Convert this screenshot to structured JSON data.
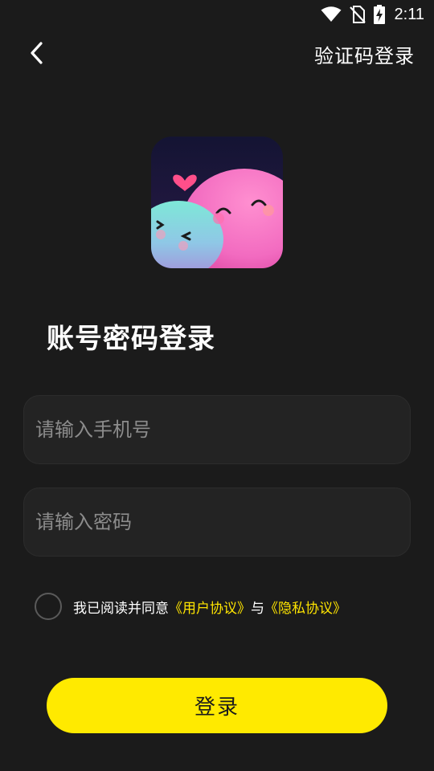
{
  "status_bar": {
    "time": "2:11"
  },
  "nav": {
    "switch_label": "验证码登录"
  },
  "title": "账号密码登录",
  "phone_input": {
    "placeholder": "请输入手机号",
    "value": ""
  },
  "password_input": {
    "placeholder": "请输入密码",
    "value": ""
  },
  "agreement": {
    "prefix": "我已阅读并同意",
    "user_agreement": "《用户协议》",
    "conjunction": "与",
    "privacy_policy": "《隐私协议》",
    "checked": false
  },
  "login_button": {
    "label": "登录"
  },
  "colors": {
    "background": "#1b1b1b",
    "accent": "#ffea00",
    "link": "#ffe500",
    "input_bg": "#232323"
  },
  "icons": [
    "wifi-icon",
    "no-sim-icon",
    "battery-charging-icon",
    "back-arrow-icon"
  ]
}
